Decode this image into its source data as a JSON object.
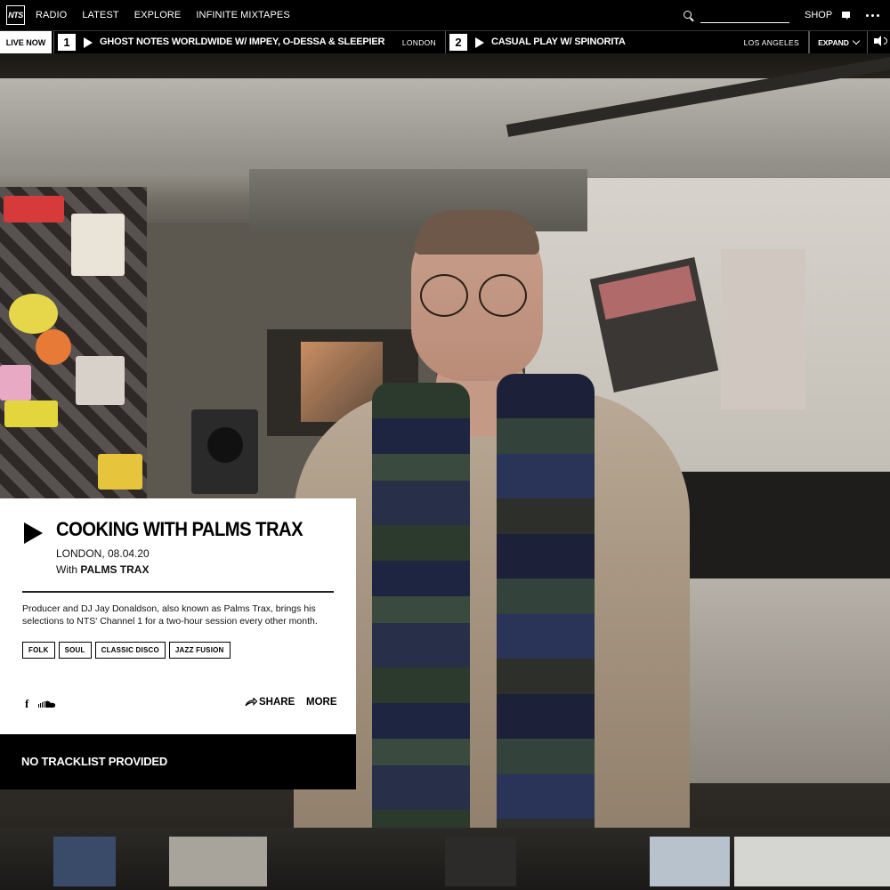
{
  "nav": {
    "logo": "NTS",
    "links": [
      "RADIO",
      "LATEST",
      "EXPLORE",
      "INFINITE MIXTAPES"
    ],
    "search_placeholder": "",
    "shop": "SHOP",
    "icons": [
      "search-icon",
      "chat-icon",
      "more-icon"
    ]
  },
  "live": {
    "label": "LIVE NOW",
    "channels": [
      {
        "number": "1",
        "title": "GHOST NOTES WORLDWIDE W/ IMPEY, O-DESSA & SLEEPIER",
        "location": "LONDON"
      },
      {
        "number": "2",
        "title": "CASUAL PLAY W/ SPINORITA",
        "location": "LOS ANGELES"
      }
    ],
    "expand": "EXPAND"
  },
  "show": {
    "title": "COOKING WITH PALMS TRAX",
    "meta": "LONDON, 08.04.20",
    "with_prefix": "With",
    "host": "PALMS TRAX",
    "description": "Producer and DJ Jay Donaldson, also known as Palms Trax, brings his selections to NTS' Channel 1 for a two-hour session every other month.",
    "tags": [
      "FOLK",
      "SOUL",
      "CLASSIC DISCO",
      "JAZZ FUSION"
    ],
    "share": "SHARE",
    "more": "MORE"
  },
  "tracklist": {
    "label": "NO TRACKLIST PROVIDED"
  },
  "colors": {
    "nav_bg": "#000000",
    "card_bg": "#ffffff",
    "text": "#000000"
  }
}
